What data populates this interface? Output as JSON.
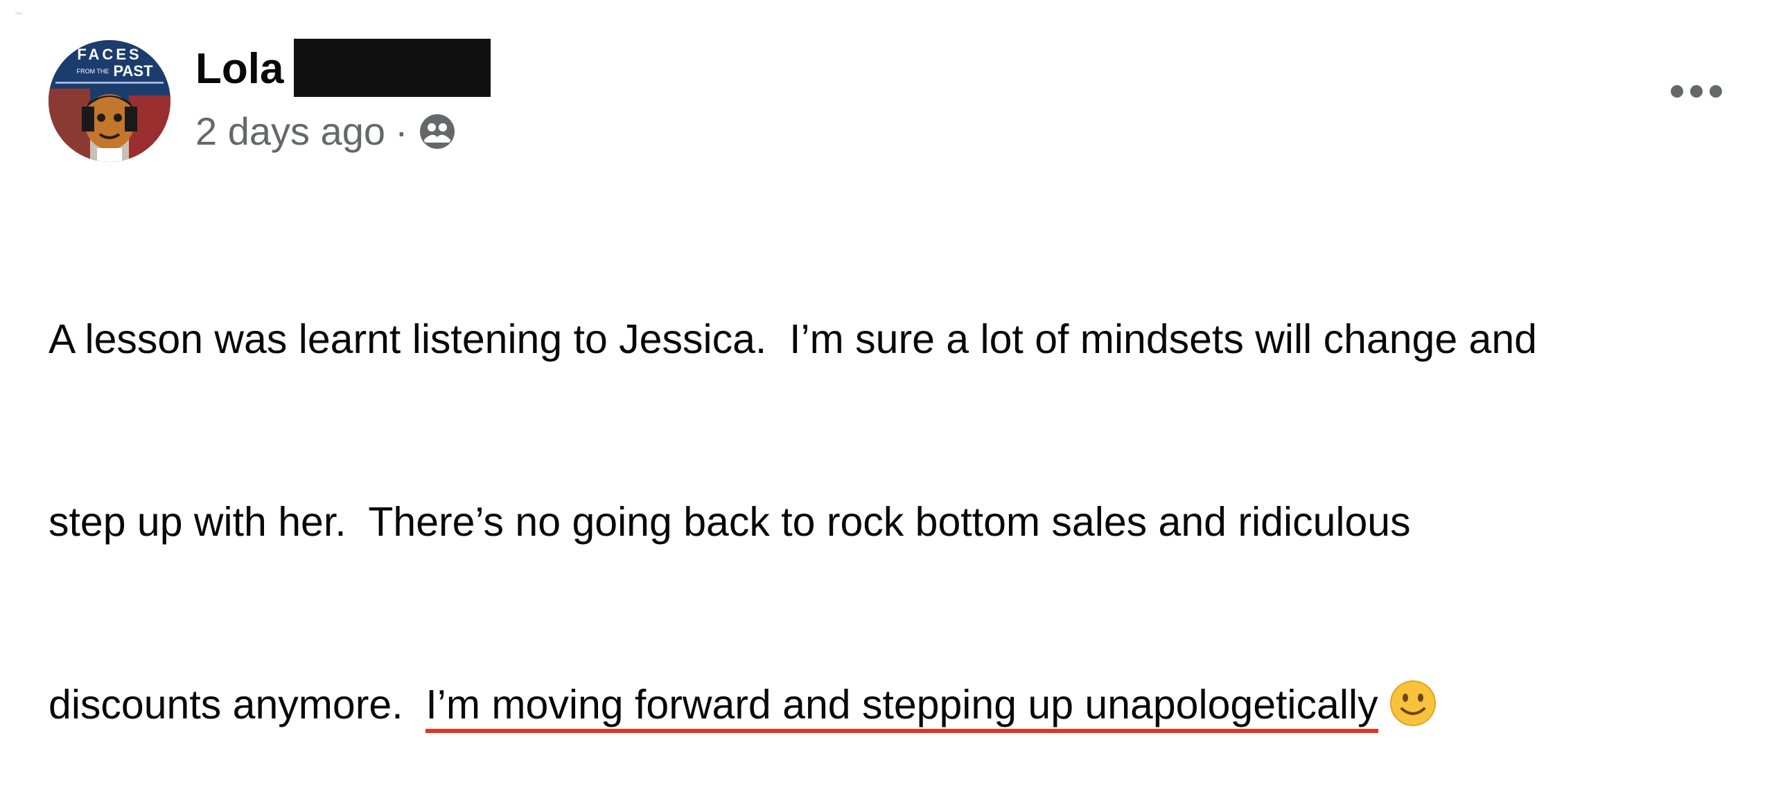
{
  "post": {
    "author": "Lola",
    "timestamp": "2 days ago",
    "separator": "·",
    "audience_icon": "friends-icon",
    "more_icon": "more-options-icon",
    "avatar": {
      "title_word": "FACES",
      "from_the": "FROM THE",
      "title_word2": "PAST"
    },
    "text_lines": [
      "A lesson was learnt listening to Jessica.  I’m sure a lot of mindsets will change and",
      "step up with her.  There’s no going back to rock bottom sales and ridiculous",
      "discounts anymore.  "
    ],
    "highlighted_text": "I’m moving forward and stepping up unapologetically",
    "emoji": "slightly-smiling-face-emoji"
  },
  "colors": {
    "text": "#080809",
    "secondary": "#65676b",
    "underline": "#e8321f"
  }
}
